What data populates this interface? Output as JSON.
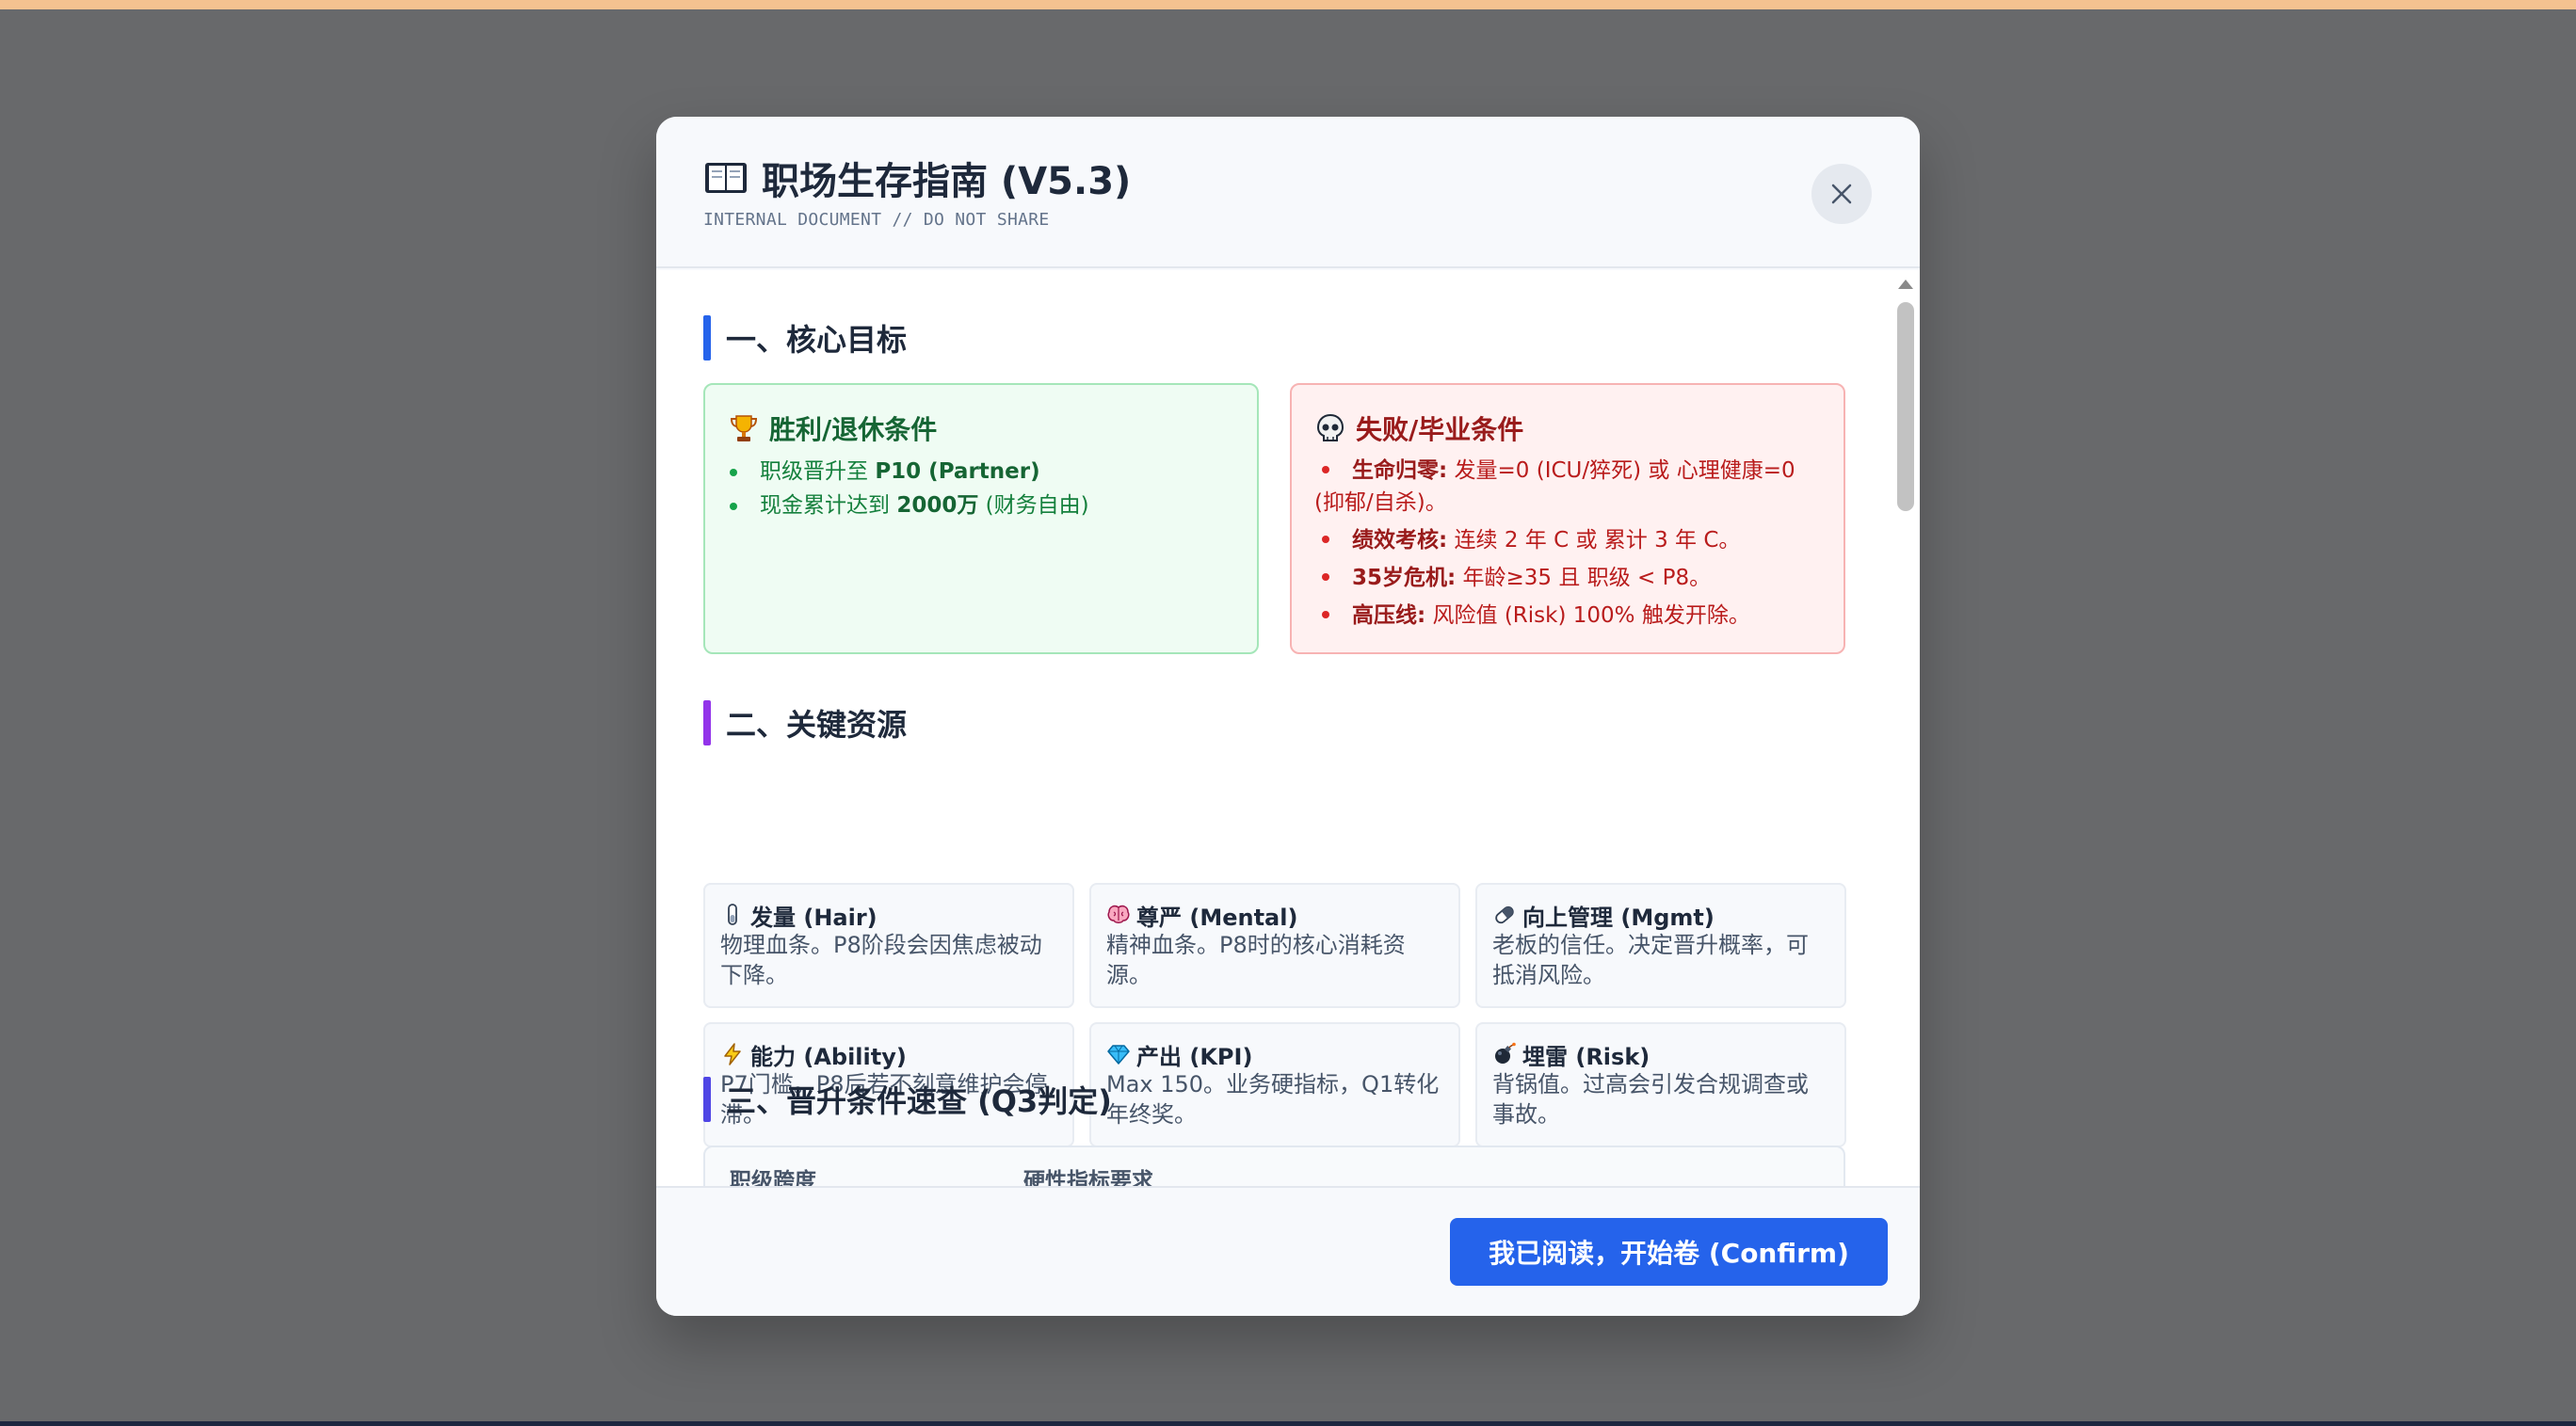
{
  "colors": {
    "backdrop": "#68696b",
    "accent_blue": "#2563eb",
    "section1_bar": "#2563eb",
    "section2_bar": "#9333ea",
    "section3_bar": "#4f46e5",
    "win_text": "#166534",
    "lose_text": "#991b1b"
  },
  "modal": {
    "title": "职场生存指南 (V5.3)",
    "title_icon": "open-book-icon",
    "subtitle": "INTERNAL DOCUMENT // DO NOT SHARE",
    "close_icon": "close-icon"
  },
  "section1": {
    "title": "一、核心目标",
    "win": {
      "icon": "trophy-icon",
      "title": "胜利/退休条件",
      "items": [
        {
          "pre": "职级晋升至 ",
          "bold": "P10 (Partner)",
          "post": ""
        },
        {
          "pre": "现金累计达到 ",
          "bold": "2000万",
          "post": " (财务自由)"
        }
      ]
    },
    "lose": {
      "icon": "skull-icon",
      "title": "失败/毕业条件",
      "items": [
        {
          "bold": "生命归零:",
          "text": " 发量=0 (ICU/猝死) 或 心理健康=0 (抑郁/自杀)。"
        },
        {
          "bold": "绩效考核:",
          "text": " 连续 2 年 C 或 累计 3 年 C。"
        },
        {
          "bold": "35岁危机:",
          "text": " 年龄≥35 且 职级 < P8。"
        },
        {
          "bold": "高压线:",
          "text": " 风险值 (Risk) 100% 触发开除。"
        }
      ]
    }
  },
  "section2": {
    "title": "二、关键资源",
    "resources": [
      {
        "icon": "test-tube-icon",
        "title": "发量 (Hair)",
        "desc": "物理血条。P8阶段会因焦虑被动下降。"
      },
      {
        "icon": "brain-icon",
        "title": "尊严 (Mental)",
        "desc": "精神血条。P8时的核心消耗资源。"
      },
      {
        "icon": "pill-icon",
        "title": "向上管理 (Mgmt)",
        "desc": "老板的信任。决定晋升概率，可抵消风险。"
      },
      {
        "icon": "lightning-icon",
        "title": "能力 (Ability)",
        "desc": "P7门槛。P8后若不刻意维护会停滞。"
      },
      {
        "icon": "gem-icon",
        "title": "产出 (KPI)",
        "desc": "Max 150。业务硬指标，Q1转化年终奖。"
      },
      {
        "icon": "bomb-icon",
        "title": "埋雷 (Risk)",
        "desc": "背锅值。过高会引发合规调查或事故。"
      }
    ]
  },
  "section3": {
    "title": "三、晋升条件速查 (Q3判定)",
    "columns": [
      "职级跨度",
      "硬性指标要求"
    ]
  },
  "footer": {
    "confirm_label": "我已阅读，开始卷 (Confirm)"
  }
}
